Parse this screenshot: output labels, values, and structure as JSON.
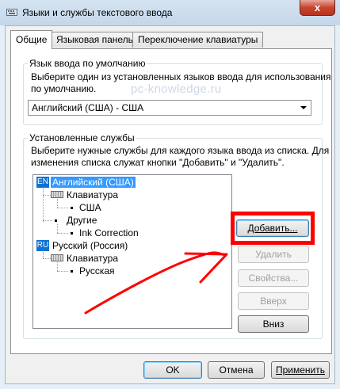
{
  "window": {
    "title": "Языки и службы текстового ввода",
    "close_glyph": "x"
  },
  "tabs": [
    {
      "label": "Общие",
      "active": true
    },
    {
      "label": "Языковая панель",
      "active": false
    },
    {
      "label": "Переключение клавиатуры",
      "active": false
    }
  ],
  "default_language": {
    "caption": "Язык ввода по умолчанию",
    "description_line1": "Выберите один из установленных языков ввода для использования",
    "description_line2": "по умолчанию.",
    "selected": "Английский (США) - США"
  },
  "watermark": "pc-knowledge.ru",
  "installed_services": {
    "caption": "Установленные службы",
    "description_line1": "Выберите нужные службы для каждого языка ввода из списка. Для",
    "description_line2": "изменения списка служат кнопки \"Добавить\" и \"Удалить\".",
    "tree": {
      "en_badge": "EN",
      "en_label": "Английский (США)",
      "en_keyboard": "Клавиатура",
      "en_layout": "США",
      "en_other": "Другие",
      "en_ink": "Ink Correction",
      "ru_badge": "RU",
      "ru_label": "Русский (Россия)",
      "ru_keyboard": "Клавиатура",
      "ru_layout": "Русская"
    },
    "buttons": {
      "add": "Добавить...",
      "remove": "Удалить",
      "properties": "Свойства...",
      "up": "Вверх",
      "down": "Вниз"
    }
  },
  "footer": {
    "ok": "OK",
    "cancel": "Отмена",
    "apply": "Применить"
  },
  "colors": {
    "highlight": "#ff0000",
    "arrow": "#ff0000",
    "selection": "#3399ff",
    "lang_badge": "#0b72d6"
  }
}
